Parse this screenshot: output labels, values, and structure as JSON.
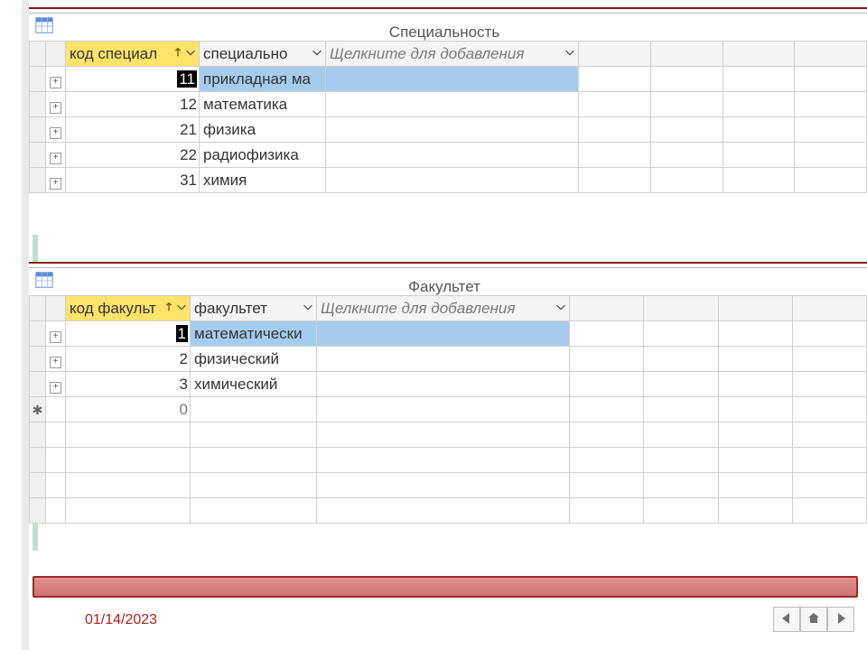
{
  "tables": [
    {
      "title": "Специальность",
      "cols": {
        "code": "код специал",
        "name": "специально",
        "add": "Щелкните для добавления"
      },
      "rows": [
        {
          "code": "11",
          "name": "прикладная ма",
          "sel": true
        },
        {
          "code": "12",
          "name": "математика"
        },
        {
          "code": "21",
          "name": "физика"
        },
        {
          "code": "22",
          "name": "радиофизика"
        },
        {
          "code": "31",
          "name": "химия"
        }
      ]
    },
    {
      "title": "Факультет",
      "cols": {
        "code": "код факульт",
        "name": "факультет",
        "add": "Щелкните для добавления"
      },
      "rows": [
        {
          "code": "1",
          "name": "математически",
          "sel": true
        },
        {
          "code": "2",
          "name": "физический"
        },
        {
          "code": "3",
          "name": "химический"
        },
        {
          "code": "0",
          "name": "",
          "new": true
        }
      ]
    }
  ],
  "footer": {
    "date": "01/14/2023"
  }
}
